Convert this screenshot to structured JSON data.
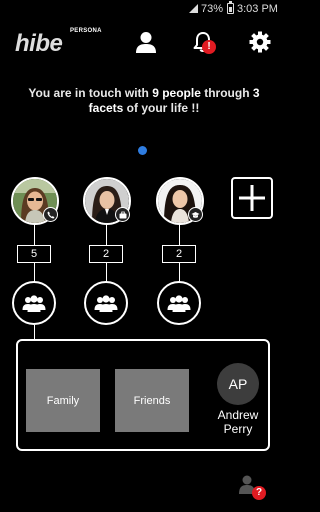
{
  "status_bar": {
    "battery": "73%",
    "time": "3:03 PM"
  },
  "header": {
    "logo_text": "hibe",
    "logo_subtitle": "PERSONA",
    "notification_badge": "!"
  },
  "summary": {
    "prefix": "You are in touch with ",
    "people": "9 people",
    "middle": " through ",
    "count": "3",
    "facets": "facets",
    "suffix": " of your life !!"
  },
  "facets": [
    {
      "badge_icon": "phone-icon",
      "count": "5"
    },
    {
      "badge_icon": "briefcase-icon",
      "count": "2"
    },
    {
      "badge_icon": "graduation-cap-icon",
      "count": "2"
    }
  ],
  "groups": [
    {
      "label": "Family"
    },
    {
      "label": "Friends"
    }
  ],
  "contact": {
    "initials": "AP",
    "name": "Andrew Perry"
  },
  "help_badge": "?",
  "colors": {
    "accent": "#2f7de1",
    "alert": "#e11b22",
    "tile": "#7a7a7a"
  }
}
